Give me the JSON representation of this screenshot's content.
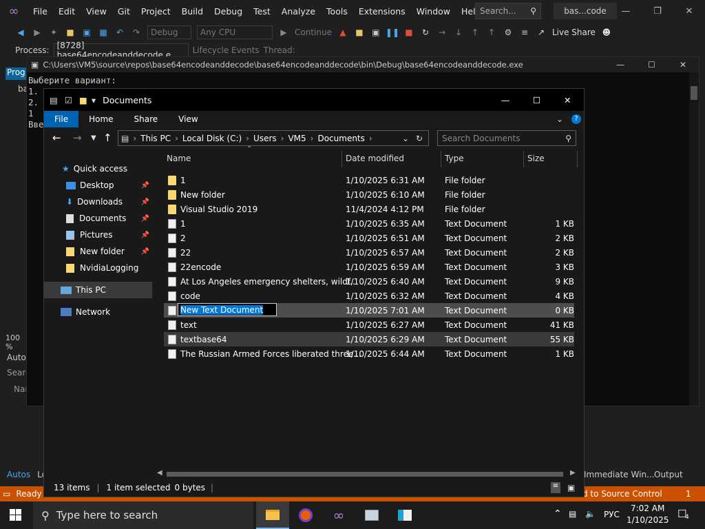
{
  "vs": {
    "menu": [
      "File",
      "Edit",
      "View",
      "Git",
      "Project",
      "Build",
      "Debug",
      "Test",
      "Analyze",
      "Tools",
      "Extensions",
      "Window",
      "Help"
    ],
    "search_placeholder": "Search...",
    "solution_name": "bas...code",
    "toolbar": {
      "config": "Debug",
      "platform": "Any CPU",
      "continue": "Continue",
      "live_share": "Live Share"
    },
    "toolbar2": {
      "process_label": "Process:",
      "process_value": "[8728] base64encodeanddecode.e",
      "lifecycle": "Lifecycle Events",
      "thread": "Thread:"
    },
    "left_fragments": {
      "prog": "Prog",
      "ba": "ba",
      "zoom": "100 %",
      "autos": "Autos",
      "search": "Searc",
      "name": "Nar"
    },
    "bottom_tabs": {
      "autos": "Autos",
      "lo": "Lo",
      "immediate": "Immediate Win...",
      "output": "Output"
    },
    "status": {
      "ready": "Ready",
      "source_control": "d to Source Control",
      "badge": "1"
    }
  },
  "console": {
    "title": "C:\\Users\\VM5\\source\\repos\\base64encodeanddecode\\base64encodeanddecode\\bin\\Debug\\base64encodeanddecode.exe",
    "lines": "Выберите вариант:\n1.\n2.\n1\nВве"
  },
  "explorer": {
    "title": "Documents",
    "ribbon_tabs": [
      "File",
      "Home",
      "Share",
      "View"
    ],
    "breadcrumb": [
      "This PC",
      "Local Disk (C:)",
      "Users",
      "VM5",
      "Documents"
    ],
    "search_placeholder": "Search Documents",
    "columns": {
      "name": "Name",
      "date": "Date modified",
      "type": "Type",
      "size": "Size"
    },
    "nav": [
      {
        "label": "Quick access",
        "icon": "star-icon"
      },
      {
        "label": "Desktop",
        "icon": "desktop-icon",
        "pinned": true
      },
      {
        "label": "Downloads",
        "icon": "download-icon",
        "pinned": true
      },
      {
        "label": "Documents",
        "icon": "documents-icon",
        "pinned": true
      },
      {
        "label": "Pictures",
        "icon": "pictures-icon",
        "pinned": true
      },
      {
        "label": "New folder",
        "icon": "folder-icon",
        "pinned": true
      },
      {
        "label": "NvidiaLogging",
        "icon": "folder-icon"
      },
      {
        "label": "This PC",
        "icon": "computer-icon"
      },
      {
        "label": "Network",
        "icon": "network-icon"
      }
    ],
    "files": [
      {
        "name": "1",
        "date": "1/10/2025 6:31 AM",
        "type": "File folder",
        "size": "",
        "kind": "folder"
      },
      {
        "name": "New folder",
        "date": "1/10/2025 6:10 AM",
        "type": "File folder",
        "size": "",
        "kind": "folder"
      },
      {
        "name": "Visual Studio 2019",
        "date": "11/4/2024 4:12 PM",
        "type": "File folder",
        "size": "",
        "kind": "folder"
      },
      {
        "name": "1",
        "date": "1/10/2025 6:35 AM",
        "type": "Text Document",
        "size": "1 KB",
        "kind": "doc"
      },
      {
        "name": "2",
        "date": "1/10/2025 6:51 AM",
        "type": "Text Document",
        "size": "2 KB",
        "kind": "doc"
      },
      {
        "name": "22",
        "date": "1/10/2025 6:57 AM",
        "type": "Text Document",
        "size": "2 KB",
        "kind": "doc"
      },
      {
        "name": "22encode",
        "date": "1/10/2025 6:59 AM",
        "type": "Text Document",
        "size": "3 KB",
        "kind": "doc"
      },
      {
        "name": "At Los Angeles emergency shelters, wildf...",
        "date": "1/10/2025 6:40 AM",
        "type": "Text Document",
        "size": "9 KB",
        "kind": "doc"
      },
      {
        "name": "code",
        "date": "1/10/2025 6:32 AM",
        "type": "Text Document",
        "size": "4 KB",
        "kind": "doc"
      },
      {
        "name": "New Text Document",
        "date": "1/10/2025 7:01 AM",
        "type": "Text Document",
        "size": "0 KB",
        "kind": "doc",
        "renaming": true
      },
      {
        "name": "text",
        "date": "1/10/2025 6:27 AM",
        "type": "Text Document",
        "size": "41 KB",
        "kind": "doc"
      },
      {
        "name": "textbase64",
        "date": "1/10/2025 6:29 AM",
        "type": "Text Document",
        "size": "55 KB",
        "kind": "doc"
      },
      {
        "name": "The Russian Armed Forces liberated three...",
        "date": "1/10/2025 6:44 AM",
        "type": "Text Document",
        "size": "1 KB",
        "kind": "doc"
      }
    ],
    "status": {
      "count": "13 items",
      "selected": "1 item selected",
      "bytes": "0 bytes"
    }
  },
  "taskbar": {
    "search_placeholder": "Type here to search",
    "lang": "РУС",
    "time": "7:02 AM",
    "date": "1/10/2025",
    "notif_count": "4"
  }
}
